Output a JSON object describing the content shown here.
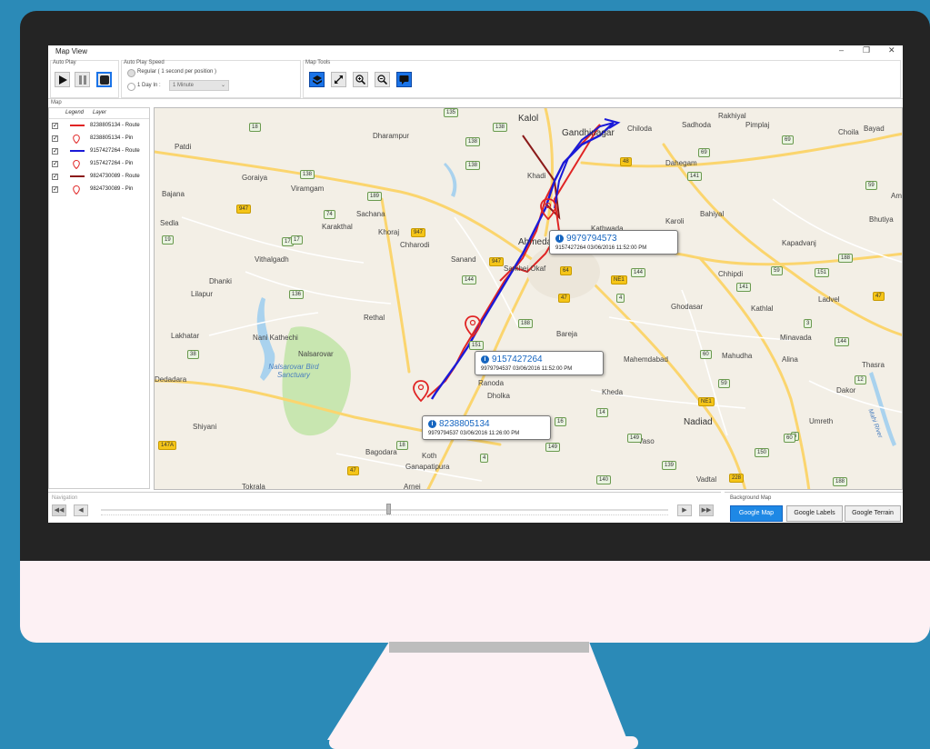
{
  "window": {
    "title": "Map View",
    "controls": [
      "–",
      "❐",
      "✕"
    ]
  },
  "toolbar": {
    "auto_play": {
      "label": "Auto Play"
    },
    "speed": {
      "label": "Auto Play Speed",
      "option_regular": "Regular ( 1 second per position )",
      "option_day": "1 Day In :",
      "dropdown_value": "1 Minute"
    },
    "map_tools": {
      "label": "Map Tools"
    }
  },
  "map_section_label": "Map",
  "legend": {
    "header_legend": "Legend",
    "header_layer": "Layer",
    "rows": [
      {
        "label": "8238805134 - Route",
        "kind": "line",
        "color": "#e02424"
      },
      {
        "label": "8238805134 - Pin",
        "kind": "pin",
        "color": "#e02424"
      },
      {
        "label": "9157427264 - Route",
        "kind": "line",
        "color": "#1a1ad8"
      },
      {
        "label": "9157427264 - Pin",
        "kind": "pin",
        "color": "#e02424"
      },
      {
        "label": "9824730089 - Route",
        "kind": "line",
        "color": "#8b1a1a"
      },
      {
        "label": "9824730089 - Pin",
        "kind": "pin",
        "color": "#e02424"
      }
    ]
  },
  "map": {
    "places": [
      "Kalol",
      "Gandhinagar",
      "Chiloda",
      "Rakhiyal",
      "Pimplaj",
      "Choila",
      "Bayad",
      "Dharampur",
      "Patdi",
      "Dahegam",
      "Goraiya",
      "Viramgam",
      "Bajana",
      "Sachana",
      "Karakthal",
      "Khoraj",
      "Chharodi",
      "Sedla",
      "Vithalgadh",
      "Bahiyal",
      "Karoli",
      "Kapadvanj",
      "Bhutiya",
      "Dhanki",
      "Lilapur",
      "Sanand",
      "Chhipdi",
      "Ghodasar",
      "Kathlal",
      "Ladvel",
      "Rethal",
      "Bareja",
      "Minavada",
      "Lakhatar",
      "Nani Kathechi",
      "Nalsarovar",
      "Mahemdabad",
      "Mahudha",
      "Alina",
      "Thasra",
      "Dedadara",
      "Ranoda",
      "Dholka",
      "Kheda",
      "Dakor",
      "Shiyani",
      "Nadiad",
      "Umreth",
      "Koth",
      "Bagodara",
      "Ganapatipura",
      "Vaso",
      "Vadtal",
      "Tokrala",
      "Arnej",
      "Sadhoda",
      "Ahmedabad",
      "Amo",
      "Khadi",
      "Kathwada",
      "Sarkhej Okaf"
    ],
    "water_labels": [
      "Nalsarovar Bird Sanctuary",
      "Mahi River"
    ],
    "shields": [
      "135",
      "138",
      "138",
      "18",
      "138",
      "48",
      "69",
      "141",
      "69",
      "59",
      "138",
      "189",
      "947",
      "74",
      "947",
      "17",
      "19",
      "136",
      "144",
      "947",
      "64",
      "NE1",
      "144",
      "59",
      "151",
      "188",
      "141",
      "47",
      "47",
      "4",
      "3",
      "188",
      "144",
      "151",
      "60",
      "59",
      "12",
      "NE1",
      "6",
      "149",
      "149",
      "16",
      "14",
      "139",
      "150",
      "60",
      "228",
      "188",
      "140",
      "147A",
      "4",
      "47",
      "38",
      "18",
      "17"
    ],
    "callouts": [
      {
        "id": "9979794573",
        "detail": "9157427264 03/06/2016 11:52:00 PM"
      },
      {
        "id": "9157427264",
        "detail": "9979794537 03/06/2016 11:52:00 PM"
      },
      {
        "id": "8238805134",
        "detail": "9979794537 03/06/2016 11:26:00 PM"
      }
    ],
    "colors": {
      "water": "#a9d2ee",
      "park": "#c8e6b0",
      "road_major": "#fbd56e",
      "road_minor": "#ffffff",
      "land": "#f3efe6"
    }
  },
  "navigation": {
    "label": "Navigation",
    "buttons": [
      "◀◀",
      "◀",
      "▶",
      "▶▶"
    ]
  },
  "background_map": {
    "label": "Background Map",
    "options": [
      "Google Map",
      "Google Labels",
      "Google Terrain"
    ],
    "selected": "Google Map"
  }
}
